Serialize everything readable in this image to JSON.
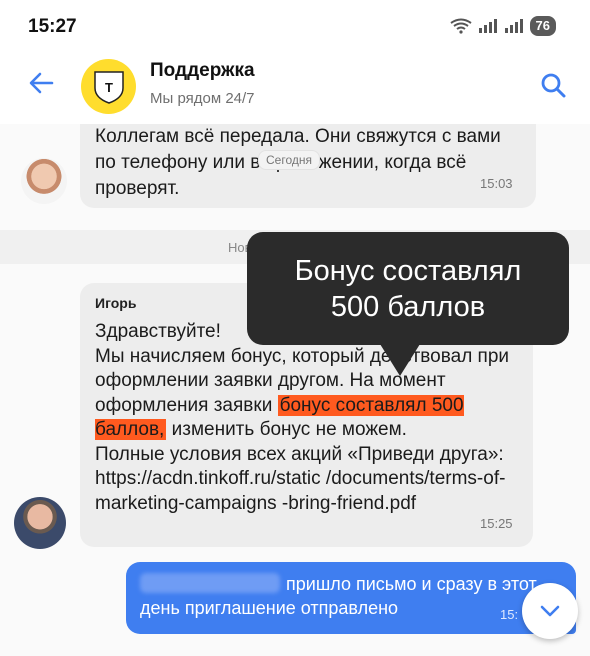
{
  "status_bar": {
    "time": "15:27",
    "battery": "76"
  },
  "header": {
    "title": "Поддержка",
    "subtitle": "Мы рядом 24/7"
  },
  "messages": [
    {
      "text": "Коллегам всё передала. Они свяжутся с вами по телефону или в приложении, когда всё проверят.",
      "time": "15:03"
    },
    {
      "sender": "Игорь",
      "part1": "Здравствуйте!\nМы начисляем бонус, который действовал при оформлении заявки другом. На момент оформления заявки ",
      "highlight": "бонус составлял 500 баллов,",
      "part2": " изменить бонус не можем.\nПолные условия всех акций «Приведи друга»: https://acdn.tinkoff.ru/static /documents/terms-of-marketing-campaigns -bring-friend.pdf",
      "time": "15:25"
    },
    {
      "line1": "пришло письмо и сразу в этот",
      "line2": "день приглашение отправлено",
      "time": "15:"
    }
  ],
  "date_chip": "Сегодня",
  "divider_text": "Новые",
  "tooltip": {
    "line1": "Бонус составлял",
    "line2": "500 баллов"
  },
  "colors": {
    "accent": "#3f7ef0",
    "highlight": "#ff5a1f",
    "brand": "#ffdd2d"
  }
}
